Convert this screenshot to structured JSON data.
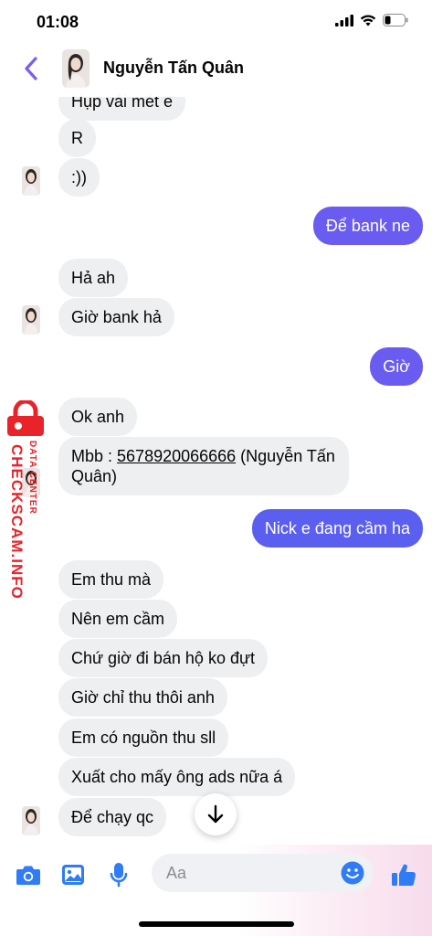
{
  "status_bar": {
    "time": "01:08"
  },
  "header": {
    "contact_name": "Nguyễn Tấn Quân"
  },
  "messages": [
    {
      "text": "Hụp vải mét e",
      "side": "in"
    },
    {
      "text": "R",
      "side": "in"
    },
    {
      "text": ":))",
      "side": "in"
    },
    {
      "text": "Để bank ne",
      "side": "out"
    },
    {
      "text": "Hả ah",
      "side": "in"
    },
    {
      "text": "Giờ bank hả",
      "side": "in"
    },
    {
      "text": "Giờ",
      "side": "out"
    },
    {
      "text": "Ok anh",
      "side": "in"
    },
    {
      "prefix": "Mbb : ",
      "number": "5678920066666",
      "suffix": " (Nguyễn Tấn Quân)",
      "side": "in"
    },
    {
      "text": "Nick e đang cầm ha",
      "side": "out"
    },
    {
      "text": "Em thu mà",
      "side": "in"
    },
    {
      "text": "Nên em cầm",
      "side": "in"
    },
    {
      "text": "Chứ giờ đi bán hộ ko đựt",
      "side": "in"
    },
    {
      "text": "Giờ chỉ thu thôi anh",
      "side": "in"
    },
    {
      "text": "Em có nguồn thu sll",
      "side": "in"
    },
    {
      "text": "Xuất cho mấy ông ads nữa á",
      "side": "in"
    },
    {
      "text": "Để chạy qc",
      "side": "in"
    }
  ],
  "composer": {
    "placeholder": "Aa"
  },
  "watermark": {
    "brand": "CHECKSCAM.INFO",
    "sub": "DATA CENTER"
  },
  "colors": {
    "outgoing": "#6a5cf0",
    "incoming": "#eeeff1",
    "accent": "#7b5cf5",
    "icons": "#2f7cf6",
    "watermark": "#e8232a"
  },
  "icons": [
    "back-chevron-icon",
    "camera-icon",
    "image-icon",
    "microphone-icon",
    "emoji-icon",
    "thumbs-up-icon",
    "arrow-down-icon",
    "lock-icon"
  ]
}
